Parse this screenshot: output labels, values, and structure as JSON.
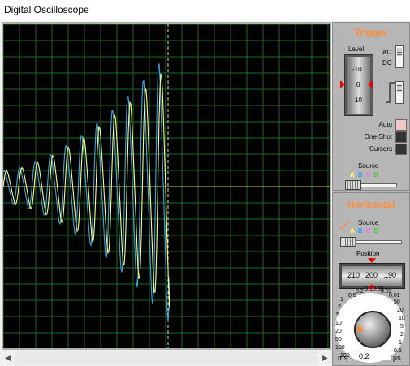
{
  "window": {
    "title": "Digital Oscilloscope"
  },
  "trigger": {
    "title": "Trigger",
    "level_label": "Level",
    "level_ticks": [
      "-10",
      "0",
      "10"
    ],
    "coupling": {
      "ac": "AC",
      "dc": "DC"
    },
    "modes": {
      "auto": "Auto",
      "one_shot": "One-Shot",
      "cursors": "Cursors"
    },
    "source_label": "Source",
    "source_channels": [
      "A",
      "B",
      "C",
      "D"
    ]
  },
  "horizontal": {
    "title": "Horizontal",
    "source_label": "Source",
    "source_channels": [
      "A",
      "B",
      "C",
      "D"
    ],
    "position_label": "Position",
    "position_values": [
      "210",
      "200",
      "190"
    ],
    "timebase_value": "0.2",
    "unit_left": "ms",
    "unit_right": "µs",
    "dial_labels_left": [
      "1",
      "2",
      "5",
      "10",
      "20",
      "50",
      "100",
      "200"
    ],
    "dial_labels_top": [
      "0.5",
      "0.2",
      "0.1",
      "0.05",
      "0.02",
      "0.01"
    ],
    "dial_labels_right": [
      "50",
      "20",
      "10",
      "5",
      "2",
      "1",
      "0.5"
    ]
  },
  "colors": {
    "channel_a": "#ffff66",
    "channel_b": "#3399ff",
    "channel_c": "#ff66ff",
    "channel_d": "#33cc33",
    "accent": "#ff8c32"
  }
}
